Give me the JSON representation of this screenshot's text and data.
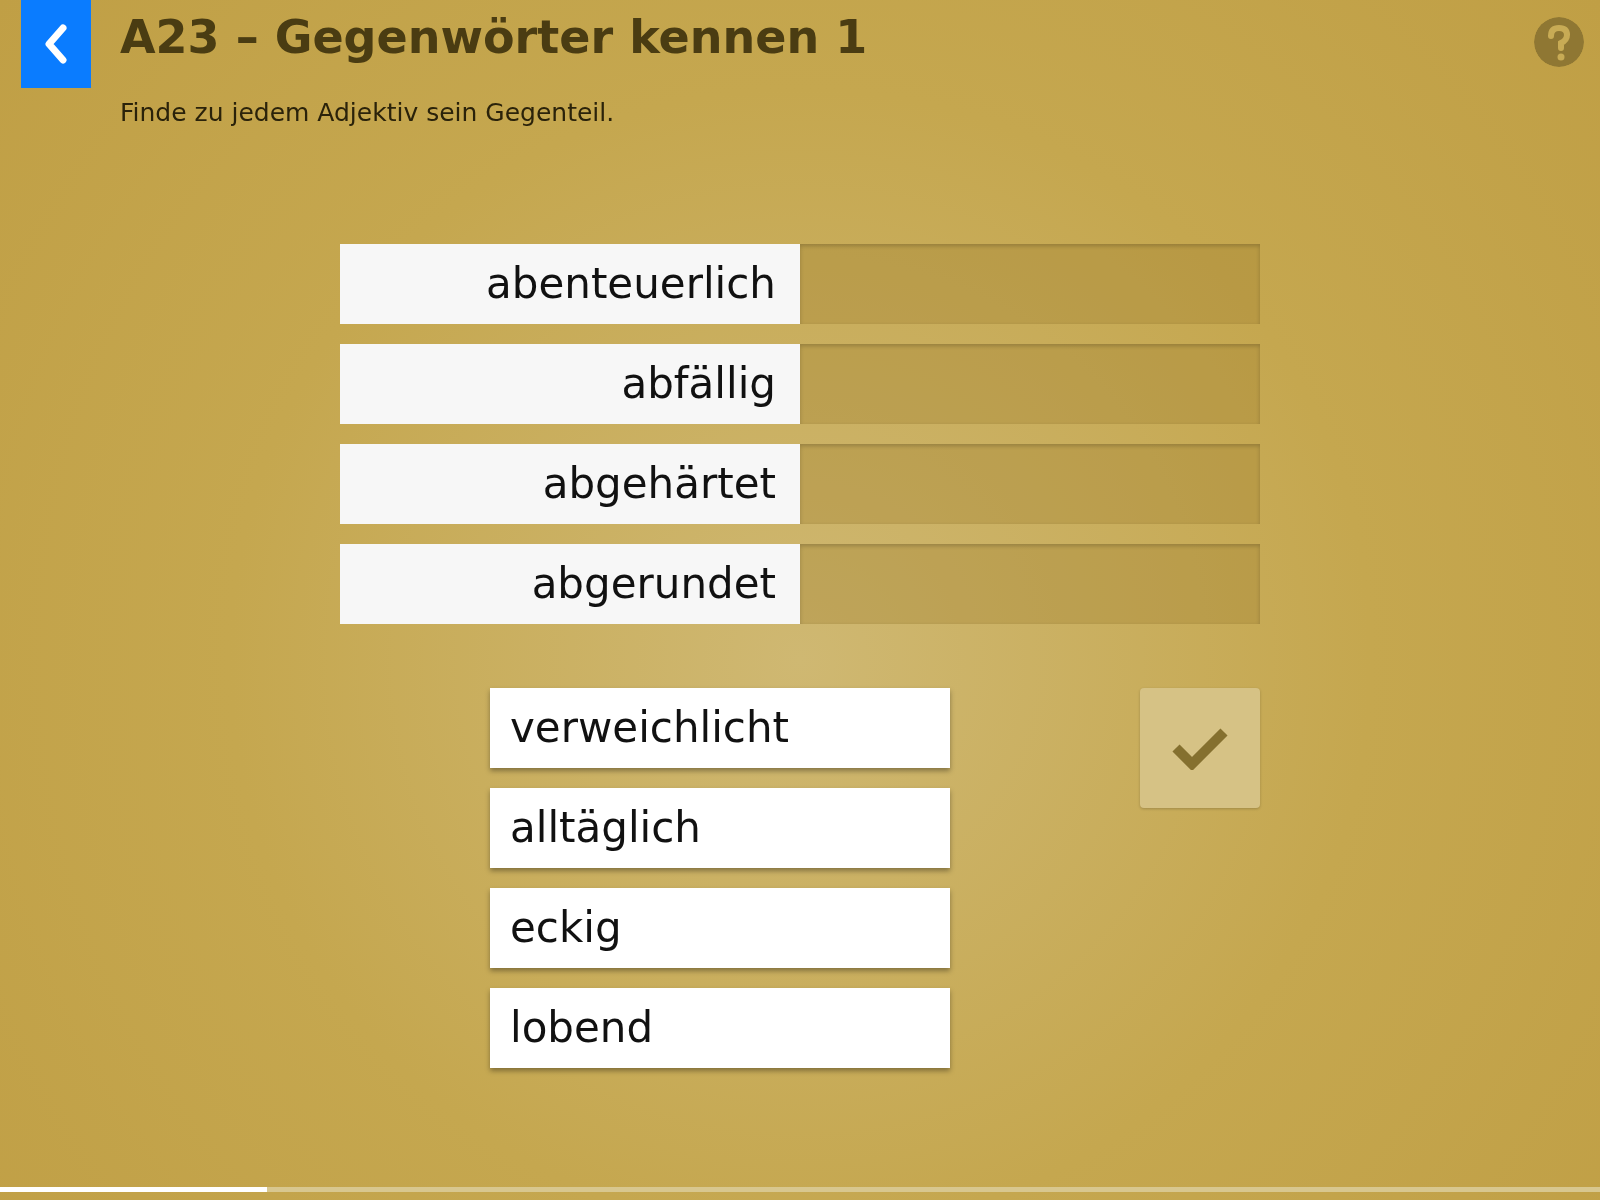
{
  "header": {
    "title": "A23 – Gegenwörter kennen 1",
    "instruction": "Finde zu jedem Adjektiv sein Gegenteil."
  },
  "pairs": [
    {
      "word": "abenteuerlich"
    },
    {
      "word": "abfällig"
    },
    {
      "word": "abgehärtet"
    },
    {
      "word": "abgerundet"
    }
  ],
  "options": [
    {
      "word": "verweichlicht"
    },
    {
      "word": "alltäglich"
    },
    {
      "word": "eckig"
    },
    {
      "word": "lobend"
    }
  ],
  "check_button": {
    "disabled": true
  },
  "progress": {
    "level": 0.167
  }
}
